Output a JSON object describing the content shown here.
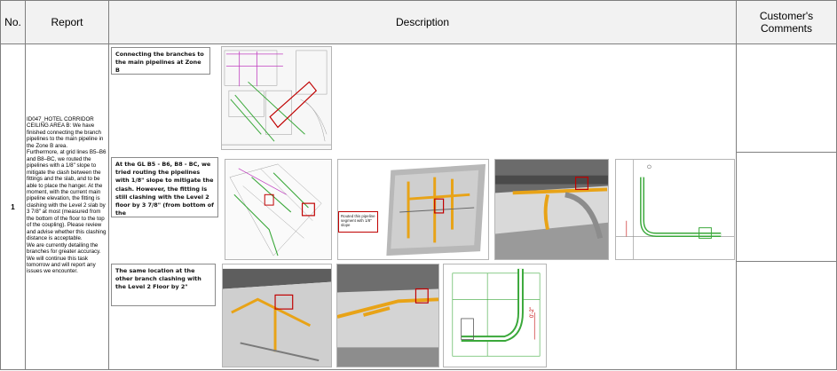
{
  "header": {
    "no": "No.",
    "report": "Report",
    "description": "Description",
    "customer_comments": "Customer's Comments"
  },
  "row": {
    "number": "1",
    "report_text": "ID047_HOTEL CORRIDOR CEILING AREA B: We have finished connecting the branch pipelines to the main pipeline in the Zone B area.\nFurthermore, at grid lines B5–B6 and B8–BC, we routed the pipelines with a 1/8\" slope to mitigate the clash between the fittings and the slab, and to be able to place the hanger. At the moment, with the current main pipeline elevation, the fitting is clashing with the Level 2 slab by 3 7/8\" at most (measured from the bottom of the floor to the top of the coupling). Please review and advise whether this clashing distance is acceptable.\nWe are currently detailing the branches for greater accuracy. We will continue this task tomorrow and will report any issues we encounter."
  },
  "callouts": {
    "branches": "Connecting the branches to the main pipelines at Zone B",
    "routing": "At the  GL B5 - B6, B8 - BC, we tried routing the pipelines with 1/8\" slope to mitigate the clash. However, the fitting is still clashing with the Level 2 floor by 3 7/8\" (from bottom of the",
    "same_location": "The same location at the other branch clashing with the Level 2 Floor by 2\""
  },
  "screenshots": {
    "routed_note": "Routed this pipeline segment with 1/8\" slope",
    "dimension_label": "0'-2\""
  },
  "colors": {
    "grid": "#7f7f7f",
    "header_bg": "#f2f2f2",
    "clash_red": "#c00000",
    "pipe_orange": "#e8a317",
    "pipe_green": "#3aa83a",
    "duct_magenta": "#c040c0"
  }
}
